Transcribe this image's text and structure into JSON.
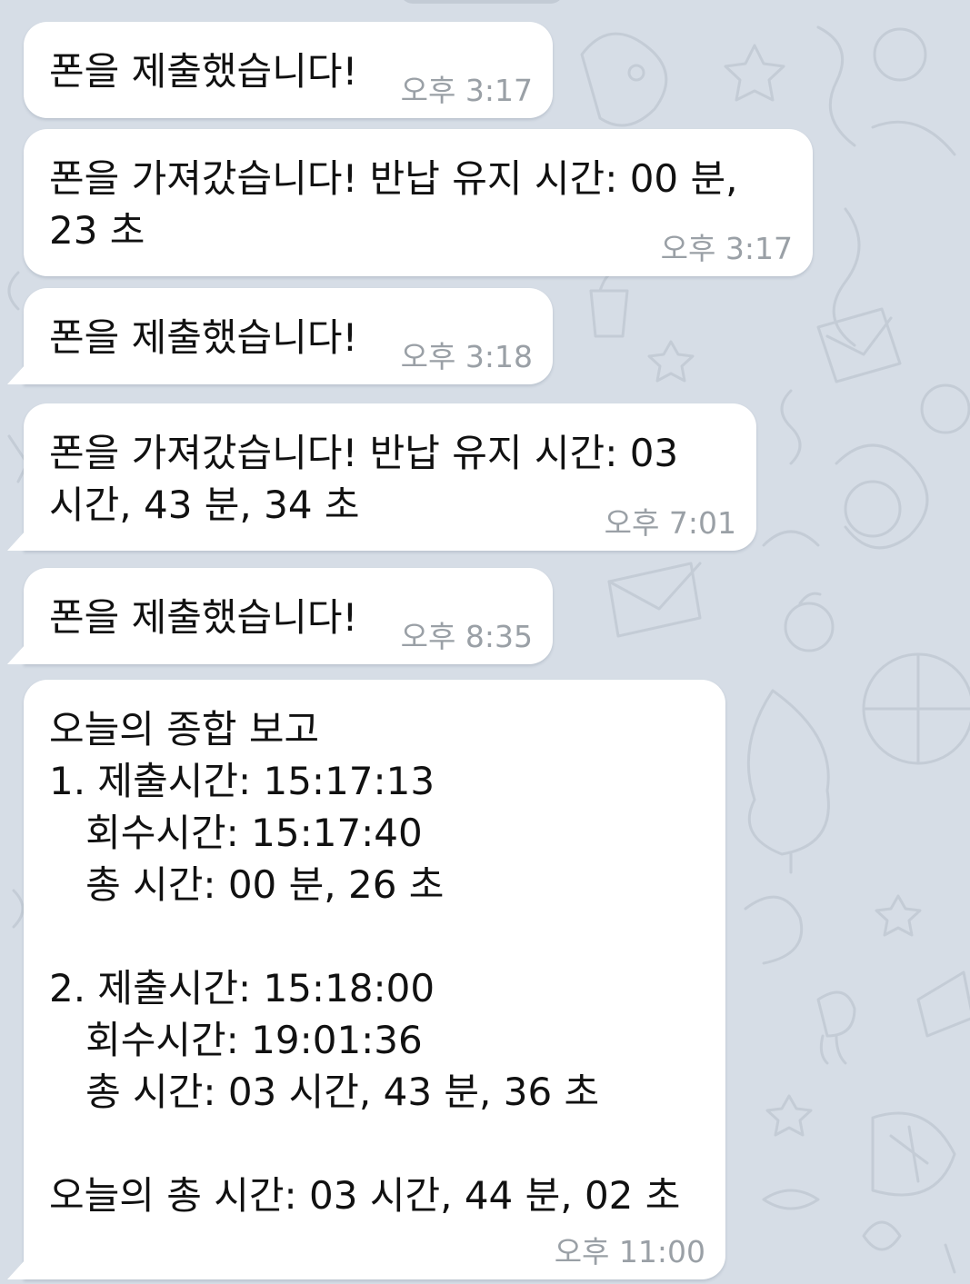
{
  "chat": {
    "messages": [
      {
        "text": "폰을 제출했습니다!",
        "time": "오후 3:17"
      },
      {
        "text": "폰을 가져갔습니다! 반납 유지 시간: 00 분,\n23 초",
        "time": "오후 3:17"
      },
      {
        "text": "폰을 제출했습니다!",
        "time": "오후 3:18"
      },
      {
        "text": "폰을 가져갔습니다! 반납 유지 시간: 03\n시간, 43 분, 34 초",
        "time": "오후 7:01"
      },
      {
        "text": "폰을 제출했습니다!",
        "time": "오후 8:35"
      },
      {
        "text": "오늘의 종합 보고\n1. 제출시간: 15:17:13\n   회수시간: 15:17:40\n   총 시간: 00 분, 26 초\n\n2. 제출시간: 15:18:00\n   회수시간: 19:01:36\n   총 시간: 03 시간, 43 분, 36 초\n\n오늘의 총 시간: 03 시간, 44 분, 02 초",
        "time": "오후 11:00"
      }
    ]
  },
  "colors": {
    "background": "#d6dde6",
    "bubble": "#ffffff",
    "timestamp": "#9aa0a6",
    "text": "#111111"
  }
}
